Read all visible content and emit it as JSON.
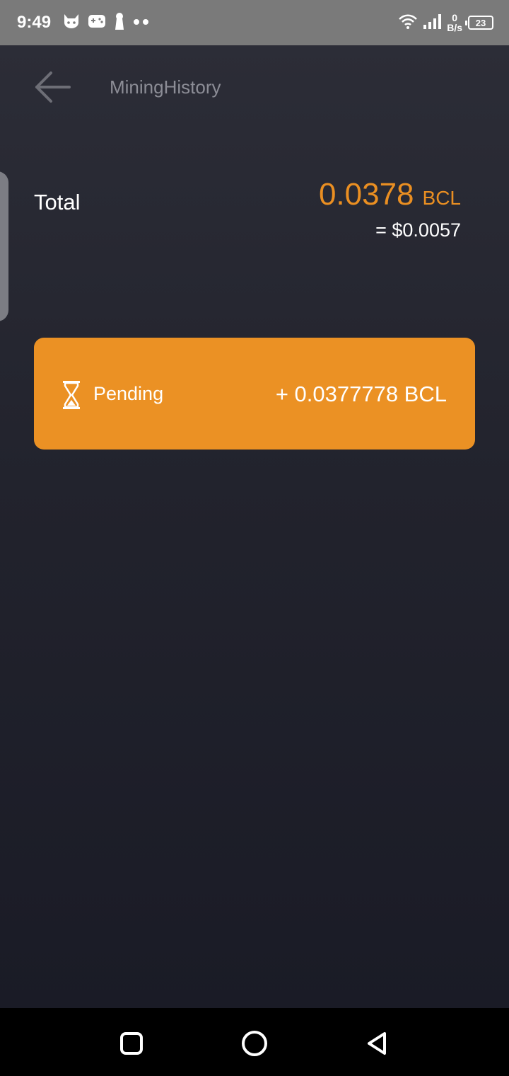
{
  "status_bar": {
    "time": "9:49",
    "net_speed_value": "0",
    "net_speed_unit": "B/s",
    "battery": "23"
  },
  "header": {
    "title": "MiningHistory"
  },
  "summary": {
    "total_label": "Total",
    "total_amount": "0.0378",
    "total_unit": "BCL",
    "usd_value": "= $0.0057"
  },
  "pending": {
    "label": "Pending",
    "amount": "+ 0.0377778 BCL"
  },
  "colors": {
    "accent": "#eb9124",
    "background": "#1c1d27",
    "status_bar": "#7a7a7a"
  },
  "icons": {
    "back": "arrow-left-icon",
    "pending": "hourglass-icon",
    "nav_recents": "square-icon",
    "nav_home": "circle-icon",
    "nav_back": "triangle-back-icon"
  }
}
